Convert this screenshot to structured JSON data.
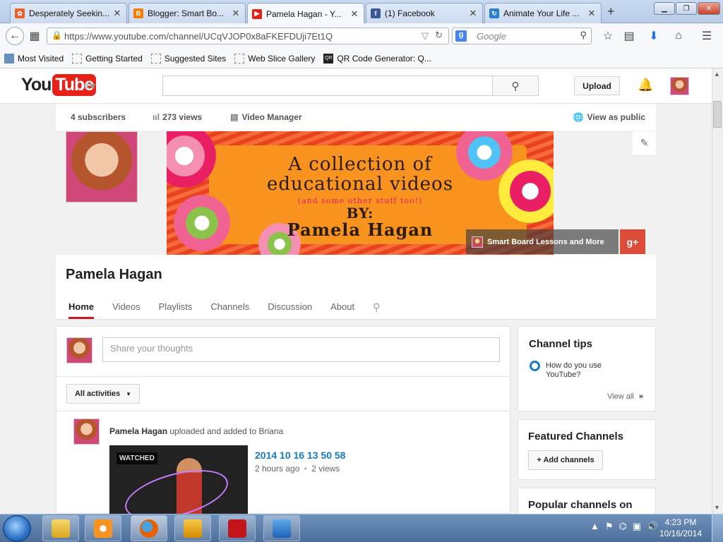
{
  "browser": {
    "tabs": [
      {
        "label": "Desperately Seekin...",
        "icon": "pinterest-like-icon",
        "color": "#e8632b"
      },
      {
        "label": "Blogger: Smart Bo...",
        "icon": "blogger-icon",
        "color": "#f57d00"
      },
      {
        "label": "Pamela Hagan - Y...",
        "icon": "youtube-icon",
        "color": "#e62117",
        "active": true
      },
      {
        "label": "(1) Facebook",
        "icon": "facebook-icon",
        "color": "#3b5998"
      },
      {
        "label": "Animate Your Life ...",
        "icon": "animate-icon",
        "color": "#2a7fd4"
      }
    ],
    "new_tab": "+",
    "url": "https://www.youtube.com/channel/UCqVJOP0x8aFKEFDUji7Et1Q",
    "search_placeholder": "Google",
    "search_engine_label": "g",
    "bookmarks": [
      "Most Visited",
      "Getting Started",
      "Suggested Sites",
      "Web Slice Gallery",
      "QR Code Generator: Q..."
    ],
    "qr_label": "QR"
  },
  "youtube": {
    "logo_you": "You",
    "logo_tube": "Tube",
    "upload_label": "Upload"
  },
  "channel": {
    "subscribers": "4 subscribers",
    "views": "273 views",
    "video_manager": "Video Manager",
    "view_as_public": "View as public",
    "banner": {
      "line1": "A collection of",
      "line2": "educational videos",
      "line3": "(and some other stuff too!)",
      "line4": "BY:",
      "line5": "Pamela Hagan"
    },
    "gplus_link": "Smart Board Lessons and More",
    "gplus_label": "g+",
    "name": "Pamela Hagan",
    "tabs": [
      "Home",
      "Videos",
      "Playlists",
      "Channels",
      "Discussion",
      "About"
    ]
  },
  "feed": {
    "share_placeholder": "Share your thoughts",
    "filter_label": "All activities",
    "activity_user": "Pamela Hagan",
    "activity_text": " uploaded and added to Briana",
    "watched_badge": "WATCHED",
    "video_title": "2014 10 16 13 50 58",
    "video_age": "2 hours ago",
    "video_views": "2 views",
    "meta_separator": "•"
  },
  "sidebar": {
    "tips_title": "Channel tips",
    "tip_item": "How do you use YouTube?",
    "view_all": "View all",
    "featured_title": "Featured Channels",
    "add_channels": "+ Add channels",
    "popular_title": "Popular channels on"
  },
  "taskbar": {
    "time": "4:23 PM",
    "date": "10/16/2014"
  }
}
